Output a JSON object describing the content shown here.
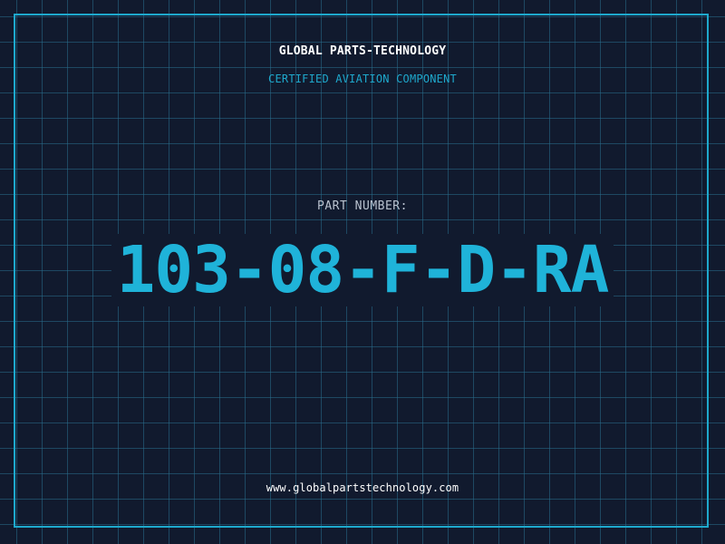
{
  "header": {
    "company": "GLOBAL PARTS-TECHNOLOGY",
    "subtitle": "CERTIFIED AVIATION COMPONENT"
  },
  "part": {
    "label": "PART NUMBER:",
    "number": "103-08-F-D-RA"
  },
  "footer": {
    "url": "www.globalpartstechnology.com"
  },
  "colors": {
    "background": "#111a2e",
    "grid": "#286e8c",
    "accent": "#1ea8cc",
    "part_number": "#1fb3d9",
    "label": "#b9c2cf",
    "text": "#ffffff"
  }
}
